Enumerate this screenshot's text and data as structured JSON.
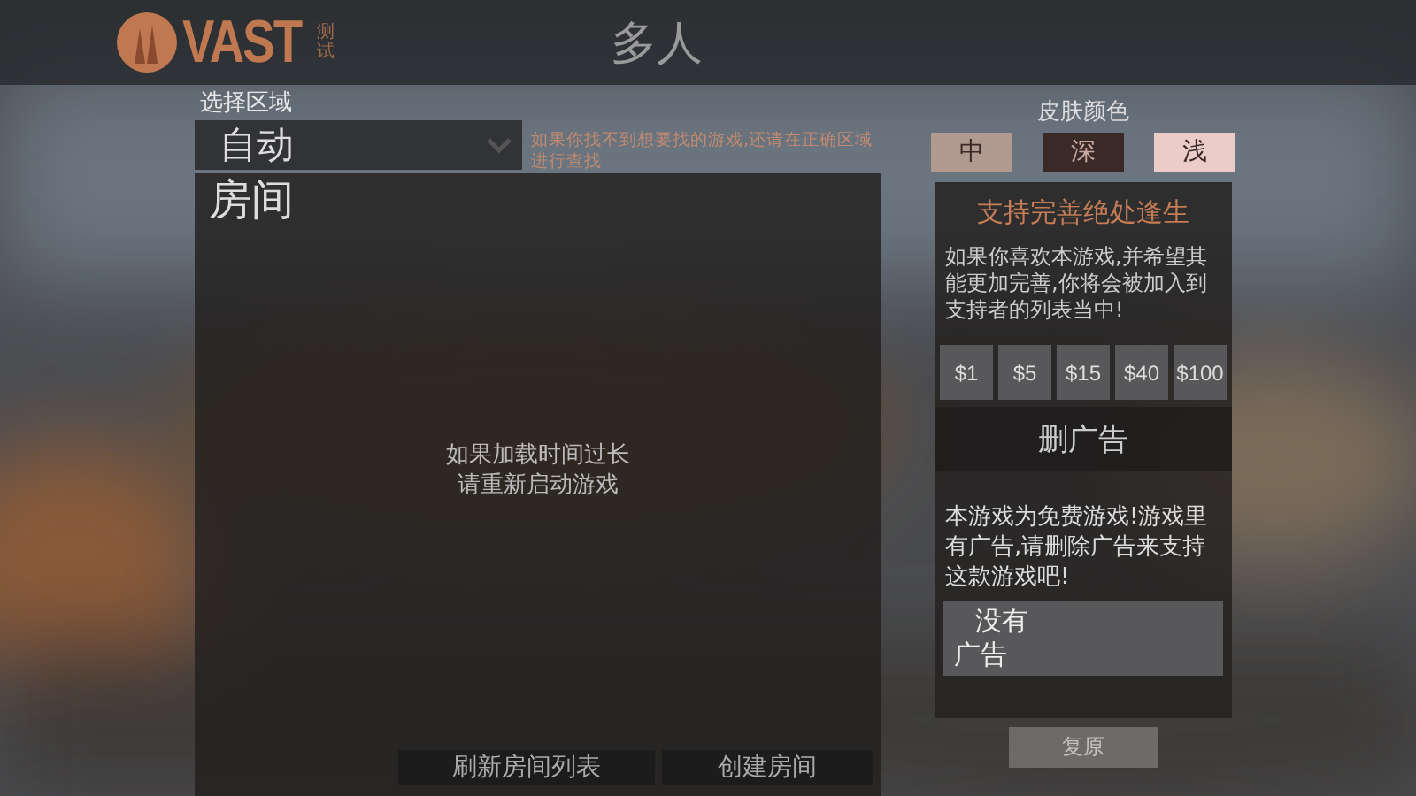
{
  "header": {
    "logo": "VAST",
    "logo_tag": "测试",
    "title": "多人"
  },
  "region": {
    "label": "选择区域",
    "value": "自动",
    "hint": "如果你找不到想要找的游戏,还请在正确区域进行查找"
  },
  "rooms": {
    "title": "房间",
    "message_lines": [
      "如果加载时间过长",
      "请重新启动游戏"
    ],
    "buttons": [
      "刷新房间列表",
      "创建房间"
    ]
  },
  "skin": {
    "label": "皮肤颜色",
    "options": [
      {
        "label": "中",
        "color": "#b09a90"
      },
      {
        "label": "深",
        "color": "#3a2a27"
      },
      {
        "label": "浅",
        "color": "#ecccc8"
      }
    ]
  },
  "support": {
    "title": "支持完善绝处逢生",
    "text": "如果你喜欢本游戏,并希望其能更加完善,你将会被加入到支持者的列表当中!",
    "amounts": [
      "$1",
      "$5",
      "$15",
      "$40",
      "$100"
    ],
    "ads_title": "删广告",
    "ads_text": "本游戏为免费游戏!游戏里有广告,请删除广告来支持这款游戏吧!",
    "no_ads_button": [
      "没有",
      "广告"
    ]
  },
  "restore_button": "复原"
}
